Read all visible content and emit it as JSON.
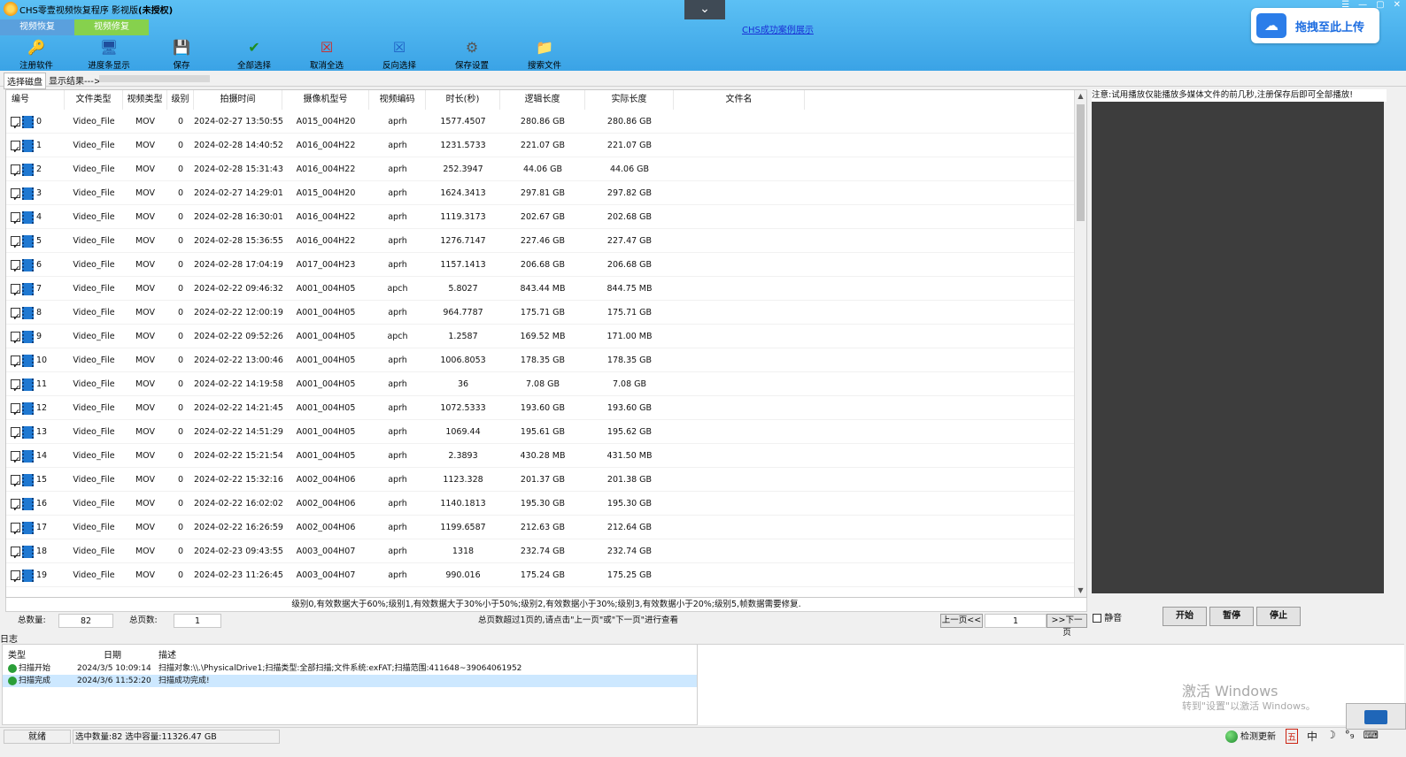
{
  "app": {
    "title": "CHS零壹视频恢复程序 影视版",
    "title_suffix": "(未授权)",
    "dropdown_glyph": "⌄",
    "case_link": "CHS成功案例展示",
    "upload_button": "拖拽至此上传"
  },
  "tabs": [
    {
      "label": "视频恢复",
      "active": false
    },
    {
      "label": "视频修复",
      "active": true
    }
  ],
  "toolbar": [
    {
      "label": "注册软件",
      "icon": "register-icon",
      "glyph": "🔑"
    },
    {
      "label": "进度条显示",
      "icon": "progress-icon",
      "glyph": "🖥"
    },
    {
      "label": "保存",
      "icon": "save-icon",
      "glyph": "💾"
    },
    {
      "label": "全部选择",
      "icon": "select-all-icon",
      "glyph": "✔"
    },
    {
      "label": "取消全选",
      "icon": "deselect-all-icon",
      "glyph": "☒"
    },
    {
      "label": "反向选择",
      "icon": "invert-selection-icon",
      "glyph": "☒"
    },
    {
      "label": "保存设置",
      "icon": "save-settings-icon",
      "glyph": "⚙"
    },
    {
      "label": "搜索文件",
      "icon": "search-file-icon",
      "glyph": "📁"
    }
  ],
  "disk_row": {
    "select_disk": "选择磁盘",
    "result_label": "显示结果--->"
  },
  "table": {
    "columns": [
      "编号",
      "文件类型",
      "视频类型",
      "级别",
      "拍摄时间",
      "摄像机型号",
      "视频编码",
      "时长(秒)",
      "逻辑长度",
      "实际长度",
      "文件名"
    ],
    "rows": [
      {
        "id": "0",
        "type": "Video_File",
        "vtype": "MOV",
        "level": "0",
        "time": "2024-02-27 13:50:55",
        "camera": "A015_004H20",
        "codec": "aprh",
        "duration": "1577.4507",
        "logical": "280.86 GB",
        "actual": "280.86 GB"
      },
      {
        "id": "1",
        "type": "Video_File",
        "vtype": "MOV",
        "level": "0",
        "time": "2024-02-28 14:40:52",
        "camera": "A016_004H22",
        "codec": "aprh",
        "duration": "1231.5733",
        "logical": "221.07 GB",
        "actual": "221.07 GB"
      },
      {
        "id": "2",
        "type": "Video_File",
        "vtype": "MOV",
        "level": "0",
        "time": "2024-02-28 15:31:43",
        "camera": "A016_004H22",
        "codec": "aprh",
        "duration": "252.3947",
        "logical": "44.06 GB",
        "actual": "44.06 GB"
      },
      {
        "id": "3",
        "type": "Video_File",
        "vtype": "MOV",
        "level": "0",
        "time": "2024-02-27 14:29:01",
        "camera": "A015_004H20",
        "codec": "aprh",
        "duration": "1624.3413",
        "logical": "297.81 GB",
        "actual": "297.82 GB"
      },
      {
        "id": "4",
        "type": "Video_File",
        "vtype": "MOV",
        "level": "0",
        "time": "2024-02-28 16:30:01",
        "camera": "A016_004H22",
        "codec": "aprh",
        "duration": "1119.3173",
        "logical": "202.67 GB",
        "actual": "202.68 GB"
      },
      {
        "id": "5",
        "type": "Video_File",
        "vtype": "MOV",
        "level": "0",
        "time": "2024-02-28 15:36:55",
        "camera": "A016_004H22",
        "codec": "aprh",
        "duration": "1276.7147",
        "logical": "227.46 GB",
        "actual": "227.47 GB"
      },
      {
        "id": "6",
        "type": "Video_File",
        "vtype": "MOV",
        "level": "0",
        "time": "2024-02-28 17:04:19",
        "camera": "A017_004H23",
        "codec": "aprh",
        "duration": "1157.1413",
        "logical": "206.68 GB",
        "actual": "206.68 GB"
      },
      {
        "id": "7",
        "type": "Video_File",
        "vtype": "MOV",
        "level": "0",
        "time": "2024-02-22 09:46:32",
        "camera": "A001_004H05",
        "codec": "apch",
        "duration": "5.8027",
        "logical": "843.44 MB",
        "actual": "844.75 MB"
      },
      {
        "id": "8",
        "type": "Video_File",
        "vtype": "MOV",
        "level": "0",
        "time": "2024-02-22 12:00:19",
        "camera": "A001_004H05",
        "codec": "aprh",
        "duration": "964.7787",
        "logical": "175.71 GB",
        "actual": "175.71 GB"
      },
      {
        "id": "9",
        "type": "Video_File",
        "vtype": "MOV",
        "level": "0",
        "time": "2024-02-22 09:52:26",
        "camera": "A001_004H05",
        "codec": "apch",
        "duration": "1.2587",
        "logical": "169.52 MB",
        "actual": "171.00 MB"
      },
      {
        "id": "10",
        "type": "Video_File",
        "vtype": "MOV",
        "level": "0",
        "time": "2024-02-22 13:00:46",
        "camera": "A001_004H05",
        "codec": "aprh",
        "duration": "1006.8053",
        "logical": "178.35 GB",
        "actual": "178.35 GB"
      },
      {
        "id": "11",
        "type": "Video_File",
        "vtype": "MOV",
        "level": "0",
        "time": "2024-02-22 14:19:58",
        "camera": "A001_004H05",
        "codec": "aprh",
        "duration": "36",
        "logical": "7.08 GB",
        "actual": "7.08 GB"
      },
      {
        "id": "12",
        "type": "Video_File",
        "vtype": "MOV",
        "level": "0",
        "time": "2024-02-22 14:21:45",
        "camera": "A001_004H05",
        "codec": "aprh",
        "duration": "1072.5333",
        "logical": "193.60 GB",
        "actual": "193.60 GB"
      },
      {
        "id": "13",
        "type": "Video_File",
        "vtype": "MOV",
        "level": "0",
        "time": "2024-02-22 14:51:29",
        "camera": "A001_004H05",
        "codec": "aprh",
        "duration": "1069.44",
        "logical": "195.61 GB",
        "actual": "195.62 GB"
      },
      {
        "id": "14",
        "type": "Video_File",
        "vtype": "MOV",
        "level": "0",
        "time": "2024-02-22 15:21:54",
        "camera": "A001_004H05",
        "codec": "aprh",
        "duration": "2.3893",
        "logical": "430.28 MB",
        "actual": "431.50 MB"
      },
      {
        "id": "15",
        "type": "Video_File",
        "vtype": "MOV",
        "level": "0",
        "time": "2024-02-22 15:32:16",
        "camera": "A002_004H06",
        "codec": "aprh",
        "duration": "1123.328",
        "logical": "201.37 GB",
        "actual": "201.38 GB"
      },
      {
        "id": "16",
        "type": "Video_File",
        "vtype": "MOV",
        "level": "0",
        "time": "2024-02-22 16:02:02",
        "camera": "A002_004H06",
        "codec": "aprh",
        "duration": "1140.1813",
        "logical": "195.30 GB",
        "actual": "195.30 GB"
      },
      {
        "id": "17",
        "type": "Video_File",
        "vtype": "MOV",
        "level": "0",
        "time": "2024-02-22 16:26:59",
        "camera": "A002_004H06",
        "codec": "aprh",
        "duration": "1199.6587",
        "logical": "212.63 GB",
        "actual": "212.64 GB"
      },
      {
        "id": "18",
        "type": "Video_File",
        "vtype": "MOV",
        "level": "0",
        "time": "2024-02-23 09:43:55",
        "camera": "A003_004H07",
        "codec": "aprh",
        "duration": "1318",
        "logical": "232.74 GB",
        "actual": "232.74 GB"
      },
      {
        "id": "19",
        "type": "Video_File",
        "vtype": "MOV",
        "level": "0",
        "time": "2024-02-23 11:26:45",
        "camera": "A003_004H07",
        "codec": "aprh",
        "duration": "990.016",
        "logical": "175.24 GB",
        "actual": "175.25 GB"
      }
    ]
  },
  "legend": "级别0,有效数据大于60%;级别1,有效数据大于30%小于50%;级别2,有效数据小于30%;级别3,有效数据小于20%;级别5,帧数据需要修复.",
  "pager": {
    "total_label": "总数量:",
    "total_value": "82",
    "pages_label": "总页数:",
    "pages_value": "1",
    "hint": "总页数超过1页的,请点击\"上一页\"或\"下一页\"进行查看",
    "prev": "上一页<<",
    "page_input": "1",
    "next": ">>下一页"
  },
  "player": {
    "notice": "注意:试用播放仅能播放多媒体文件的前几秒,注册保存后即可全部播放!",
    "mute": "静音",
    "start": "开始",
    "pause": "暂停",
    "stop": "停止"
  },
  "log": {
    "title": "日志",
    "columns": [
      "类型",
      "日期",
      "描述"
    ],
    "rows": [
      {
        "type": "扫描开始",
        "date": "2024/3/5 10:09:14",
        "desc": "扫描对象:\\\\.\\PhysicalDrive1;扫描类型:全部扫描;文件系统:exFAT;扫描范围:411648~39064061952"
      },
      {
        "type": "扫描完成",
        "date": "2024/3/6 11:52:20",
        "desc": "扫描成功完成!"
      }
    ]
  },
  "watermark": {
    "line1": "激活 Windows",
    "line2": "转到\"设置\"以激活 Windows。"
  },
  "status": {
    "ready": "就绪",
    "info": "选中数量:82 选中容量:11326.47 GB",
    "update": "检测更新",
    "ime": [
      "五",
      "中",
      "☽",
      "°₉",
      "⌨"
    ]
  }
}
